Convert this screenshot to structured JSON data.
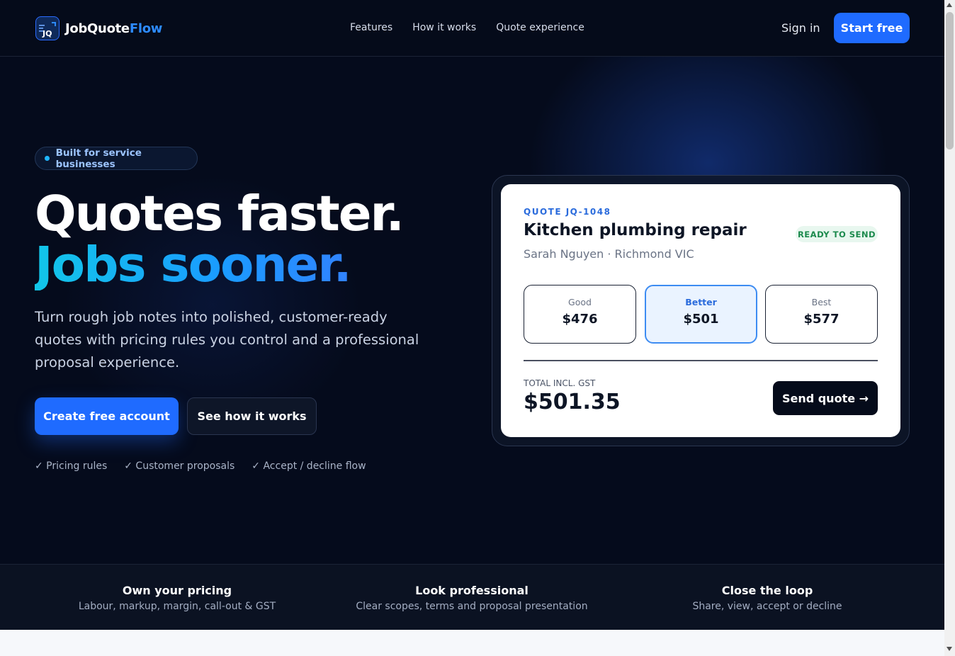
{
  "nav": {
    "brand_part1": "JobQuote",
    "brand_part2": "Flow",
    "logo_text": "JQ",
    "links": [
      "Features",
      "How it works",
      "Quote experience"
    ],
    "signin": "Sign in",
    "start_free": "Start free"
  },
  "hero": {
    "pill": "Built for service businesses",
    "headline_line1": "Quotes faster.",
    "headline_line2": "Jobs sooner.",
    "lead": "Turn rough job notes into polished, customer-ready quotes with pricing rules you control and a professional proposal experience.",
    "cta_primary": "Create free account",
    "cta_secondary": "See how it works",
    "checks": [
      "✓ Pricing rules",
      "✓ Customer proposals",
      "✓ Accept / decline flow"
    ]
  },
  "quote": {
    "id": "QUOTE JQ-1048",
    "title": "Kitchen plumbing repair",
    "customer": "Sarah Nguyen · Richmond VIC",
    "status": "READY TO SEND",
    "tiers": [
      {
        "name": "Good",
        "price": "$476"
      },
      {
        "name": "Better",
        "price": "$501"
      },
      {
        "name": "Best",
        "price": "$577"
      }
    ],
    "selected_tier": "Better",
    "total_label": "TOTAL INCL. GST",
    "total_value": "$501.35",
    "send_label": "Send quote →"
  },
  "features": [
    {
      "title": "Own your pricing",
      "desc": "Labour, markup, margin, call-out & GST"
    },
    {
      "title": "Look professional",
      "desc": "Clear scopes, terms and proposal presentation"
    },
    {
      "title": "Close the loop",
      "desc": "Share, view, accept or decline"
    }
  ],
  "colors": {
    "accent": "#1f6bff",
    "dark_bg": "#050b1c",
    "ready_green": "#1c8a4d"
  }
}
